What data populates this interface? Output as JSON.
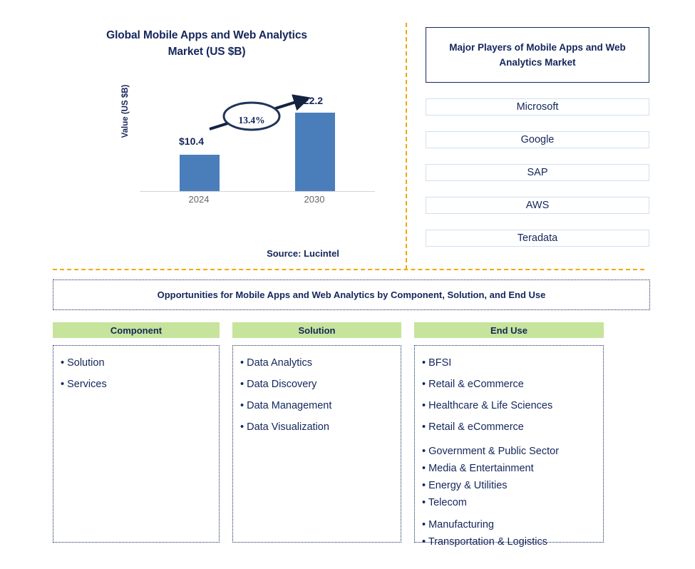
{
  "chart_panel": {
    "title": "Global Mobile Apps and Web Analytics Market (US $B)",
    "title_line1": "Global Mobile Apps and Web Analytics",
    "title_line2": "Market (US $B)",
    "y_axis_label": "Value (US $B)",
    "cagr_label": "13.4%",
    "source": "Source: Lucintel"
  },
  "chart_data": {
    "type": "bar",
    "title": "Global Mobile Apps and Web Analytics Market (US $B)",
    "xlabel": "",
    "ylabel": "Value (US $B)",
    "categories": [
      "2024",
      "2030"
    ],
    "values": [
      10.4,
      22.2
    ],
    "value_labels": [
      "$10.4",
      "$22.2"
    ],
    "cagr": "13.4%",
    "unit": "US $B",
    "ylim": [
      0,
      24
    ],
    "grid": false,
    "legend": "none",
    "bar_color": "#4A7EBB",
    "annotation": "13.4%",
    "source": "Source: Lucintel"
  },
  "players": {
    "header": "Major Players of Mobile Apps and Web Analytics Market",
    "items": [
      {
        "name": "Microsoft"
      },
      {
        "name": "Google"
      },
      {
        "name": "SAP"
      },
      {
        "name": "AWS"
      },
      {
        "name": "Teradata"
      }
    ]
  },
  "opportunities": {
    "banner": "Opportunities for Mobile Apps and Web Analytics by Component, Solution, and End Use",
    "columns": [
      {
        "header": "Component",
        "items": [
          "Solution",
          "Services"
        ]
      },
      {
        "header": "Solution",
        "items": [
          "Data Analytics",
          "Data Discovery",
          "Data Management",
          "Data Visualization"
        ]
      },
      {
        "header": "End Use",
        "items": [
          "BFSI",
          "Retail & eCommerce",
          "Healthcare & Life Sciences",
          "Retail & eCommerce",
          "Government & Public Sector",
          "Media & Entertainment",
          "Energy & Utilities",
          "Telecom",
          "Manufacturing",
          "Transportation & Logistics"
        ]
      }
    ]
  },
  "colors": {
    "navy": "#14265B",
    "bar_blue": "#4A7EBB",
    "header_green": "#C6E49B",
    "divider_orange": "#F0A800",
    "box_border_blue": "#CFE0F0"
  }
}
